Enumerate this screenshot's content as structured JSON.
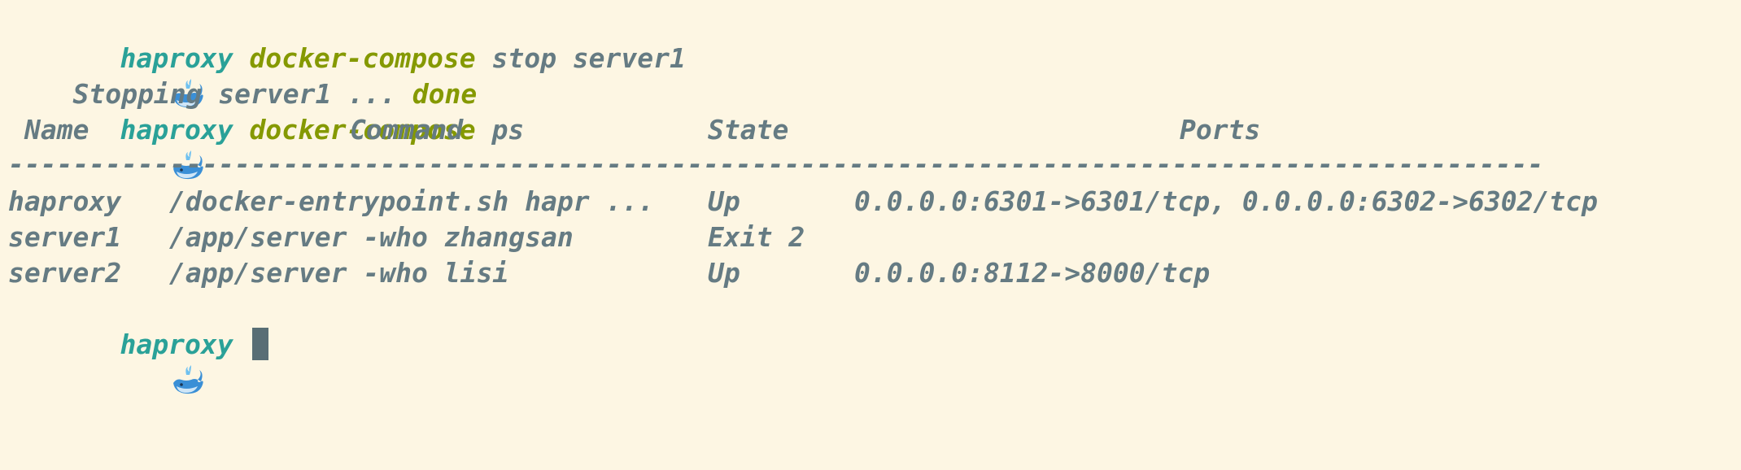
{
  "prompt": {
    "cwd": "haproxy"
  },
  "commands": [
    {
      "cmd": "docker-compose",
      "args": "stop server1"
    },
    {
      "cmd": "docker-compose",
      "args": "ps"
    }
  ],
  "stop_output": {
    "text": "Stopping server1 ...",
    "status": "done"
  },
  "ps_table": {
    "headers": [
      "Name",
      "Command",
      "State",
      "Ports"
    ],
    "separator": "-----------------------------------------------------------------------------------------------",
    "rows": [
      {
        "name": "haproxy",
        "command": "/docker-entrypoint.sh hapr ...",
        "state": "Up",
        "ports": "0.0.0.0:6301->6301/tcp, 0.0.0.0:6302->6302/tcp"
      },
      {
        "name": "server1",
        "command": "/app/server -who zhangsan",
        "state": "Exit 2",
        "ports": ""
      },
      {
        "name": "server2",
        "command": "/app/server -who lisi",
        "state": "Up",
        "ports": "0.0.0.0:8112->8000/tcp"
      }
    ]
  },
  "icons": {
    "prompt_icon": "whale-icon",
    "cursor": "block-cursor"
  },
  "colors": {
    "background": "#fdf6e3",
    "cwd": "#2aa198",
    "command": "#859900",
    "text": "#657b83",
    "cursor": "#586e75"
  }
}
